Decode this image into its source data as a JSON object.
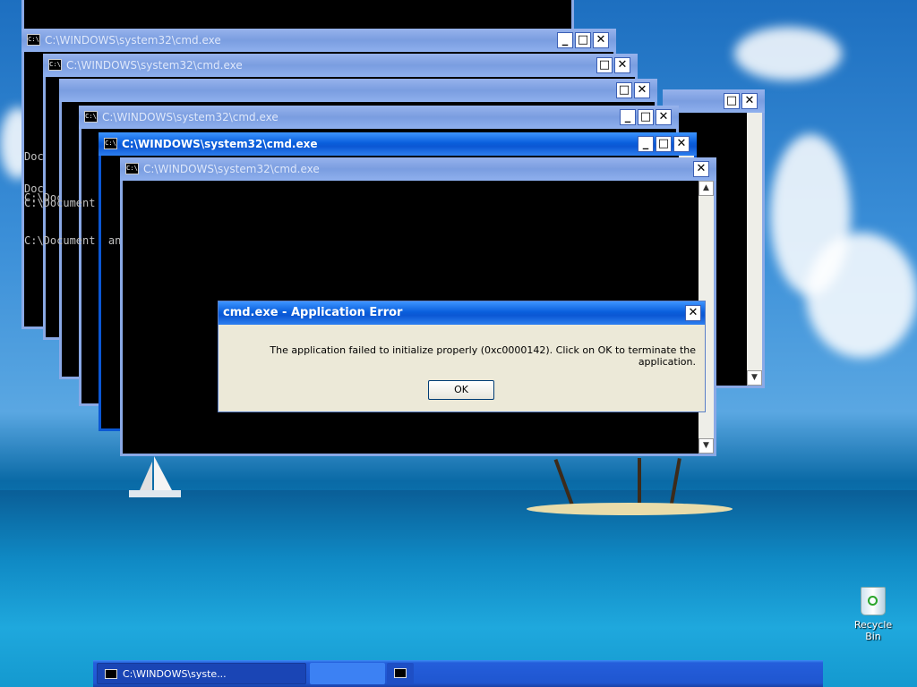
{
  "windows": {
    "title": "C:\\WINDOWS\\system32\\cmd.exe",
    "icon": "cmd-icon",
    "minimize": "_",
    "maximize": "□",
    "close": "✕",
    "console_lines": [
      "Document  and",
      "Document  and",
      "C:\\Document  and",
      "C:\\Document  and",
      "C:\\Document  and"
    ],
    "scroll_up": "▲",
    "scroll_down": "▼"
  },
  "dialog": {
    "title": "cmd.exe - Application Error",
    "message": "The application failed to initialize properly (0xc0000142). Click on OK to terminate the application.",
    "ok_label": "OK",
    "close": "✕"
  },
  "taskbar": {
    "task1_label": "C:\\WINDOWS\\syste...",
    "task2_label": ""
  },
  "desktop": {
    "recycle_bin_label": "Recycle Bin"
  },
  "colors": {
    "active_title": "#0b57d4",
    "inactive_title": "#7a9de0",
    "dialog_bg": "#ece9d8"
  }
}
